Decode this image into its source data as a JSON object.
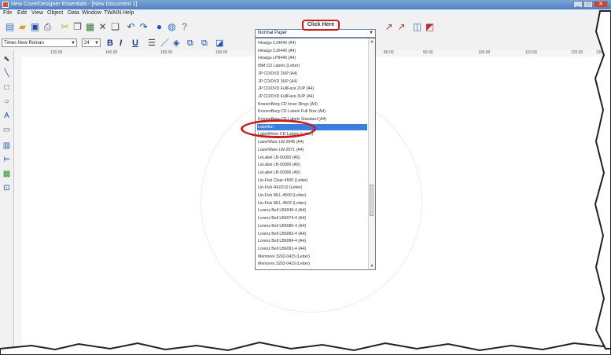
{
  "window": {
    "title": "New CoverDesigner Essentials - [New Document 1]"
  },
  "menubar": {
    "items": [
      "File",
      "Edit",
      "View",
      "Object",
      "Data",
      "Window",
      "TWAIN",
      "Help"
    ]
  },
  "format_toolbar": {
    "font_name": "Times New Roman",
    "font_size": "24"
  },
  "paper_selector": {
    "selected": "Normal Paper"
  },
  "callout": {
    "label": "Click Here"
  },
  "ruler": {
    "horizontal_labels": [
      "120.00",
      "140.00",
      "150.00",
      "160.00",
      "80.00",
      "90.00",
      "100.00",
      "110.00",
      "120.00",
      "130.00"
    ]
  },
  "paper_list": {
    "items": [
      "Hinaigo CJ4640 (A4)",
      "Hinaigo CJ6440 (A4)",
      "Hinaigo LP8440 (A4)",
      "IBM CD Labels (Letter)",
      "JP CD/DVD 2UP (A4)",
      "JP CD/DVD 3UP (A4)",
      "JP CD/DVD FullFace 2UP (A4)",
      "JP CD/DVD FullFace 3UP (A4)",
      "KronenBerg CD Inner Rings (A4)",
      "KronenBerg CD Labels Full Size (A4)",
      "KronenBerg CD Labels Standard (A4)",
      "Labelfun",
      "LabelWriter CD Labels (Letter)",
      "LaserWare LW-2946 (A4)",
      "LaserWare LW-2971 (A4)",
      "LeLabel LB-00000 (A5)",
      "LeLabel LB-00006 (A5)",
      "LeLabel LB-00006 (A5)",
      "Lin-Fisk Clear-4500 (Letter)",
      "Lin-Fisk HE0210 (Letter)",
      "Lin-Fisk MLL-4500 (Letter)",
      "Lin-Fisk MLL-4502 (Letter)",
      "Lorenz Bell LB6040-4 (A4)",
      "Lorenz Bell LB6074-4 (A4)",
      "Lorenz Bell LB6080-4 (A4)",
      "Lorenz Bell LB6082-4 (A4)",
      "Lorenz Bell LB6084-4 (A4)",
      "Lorenz Bell LB6091-4 (A4)",
      "Memorex 3202-0415 (Letter)",
      "Memorex 3202-0419 (Letter)"
    ],
    "selected_index": 11
  },
  "colors": {
    "accent": "#3c7ee0",
    "highlight_red": "#c41e1e",
    "titlebar": "#4f7fbf"
  }
}
